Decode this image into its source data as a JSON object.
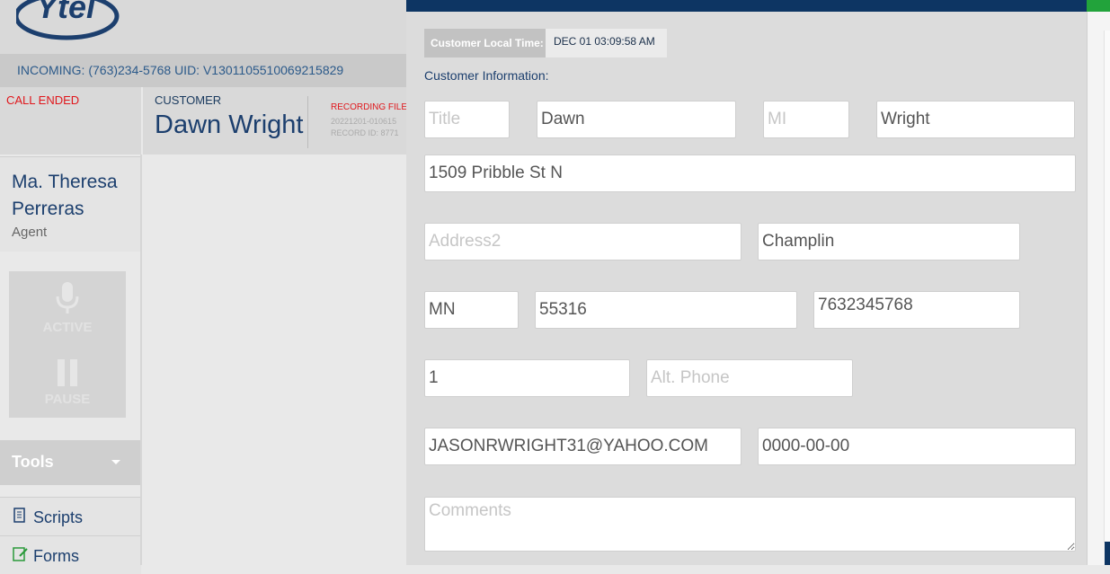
{
  "header": {
    "logo_text": "Ytel",
    "incoming_line": "INCOMING: (763)234-5768 UID: V1301105510069215829"
  },
  "call_status": "CALL ENDED",
  "customer_card": {
    "label": "CUSTOMER",
    "name": "Dawn Wright",
    "recording_label": "RECORDING FILE",
    "recording_file": "20221201-010615",
    "record_id": "RECORD ID: 8771"
  },
  "agent": {
    "name": "Ma. Theresa Perreras",
    "role": "Agent"
  },
  "mic_panel": {
    "active_label": "ACTIVE",
    "pause_label": "PAUSE"
  },
  "sidebar": {
    "tools_label": "Tools",
    "items": [
      {
        "label": "Scripts",
        "icon": "scroll-icon"
      },
      {
        "label": "Forms",
        "icon": "form-icon"
      }
    ]
  },
  "customer_time": {
    "label": "Customer Local Time:",
    "value": "DEC 01 03:09:58 AM"
  },
  "form": {
    "section_label": "Customer Information:",
    "title": {
      "value": "",
      "placeholder": "Title"
    },
    "first_name": {
      "value": "Dawn",
      "placeholder": ""
    },
    "middle_initial": {
      "value": "",
      "placeholder": "MI"
    },
    "last_name": {
      "value": "Wright",
      "placeholder": ""
    },
    "address1": {
      "value": "1509 Pribble St N",
      "placeholder": ""
    },
    "address2": {
      "value": "",
      "placeholder": "Address2"
    },
    "city": {
      "value": "Champlin",
      "placeholder": ""
    },
    "state": {
      "value": "MN",
      "placeholder": ""
    },
    "postal_code": {
      "value": "55316",
      "placeholder": ""
    },
    "phone": {
      "value": "7632345768",
      "placeholder": ""
    },
    "phone_code": {
      "value": "1",
      "placeholder": ""
    },
    "alt_phone": {
      "value": "",
      "placeholder": "Alt. Phone"
    },
    "email": {
      "value": "JASONRWRIGHT31@YAHOO.COM",
      "placeholder": ""
    },
    "date_of_birth": {
      "value": "0000-00-00",
      "placeholder": ""
    },
    "comments": {
      "value": "",
      "placeholder": "Comments"
    }
  },
  "colors": {
    "navy": "#0d3563",
    "status_red": "#e0171c",
    "accent_green": "#22a33b"
  }
}
